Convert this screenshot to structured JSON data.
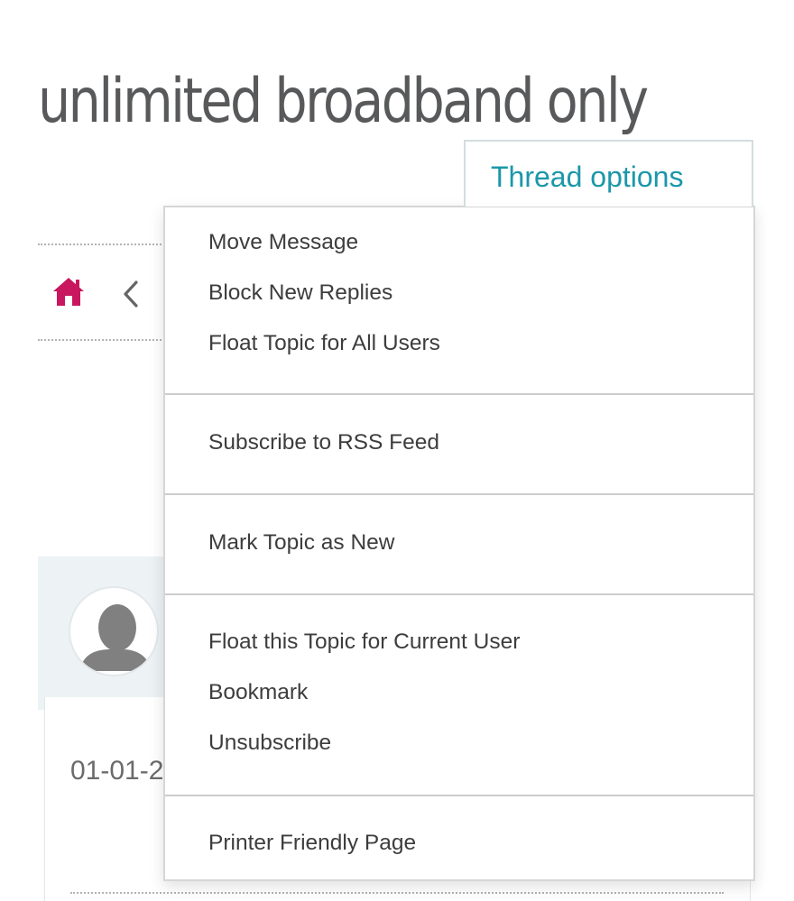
{
  "page": {
    "title": "unlimited broadband only"
  },
  "thread_options": {
    "button_label": "Thread options",
    "groups": [
      {
        "items": [
          "Move Message",
          "Block New Replies",
          "Float Topic for All Users"
        ]
      },
      {
        "items": [
          "Subscribe to RSS Feed"
        ]
      },
      {
        "items": [
          "Mark Topic as New"
        ]
      },
      {
        "items": [
          "Float this Topic for Current User",
          "Bookmark",
          "Unsubscribe"
        ]
      },
      {
        "items": [
          "Printer Friendly Page"
        ]
      }
    ]
  },
  "post": {
    "date_partial": "01-01-2"
  },
  "colors": {
    "accent": "#1b97aa",
    "home_icon": "#c8175e",
    "title": "#58595b"
  },
  "icons": {
    "home": "home-icon",
    "back": "chevron-left-icon",
    "avatar": "default-user-avatar"
  }
}
